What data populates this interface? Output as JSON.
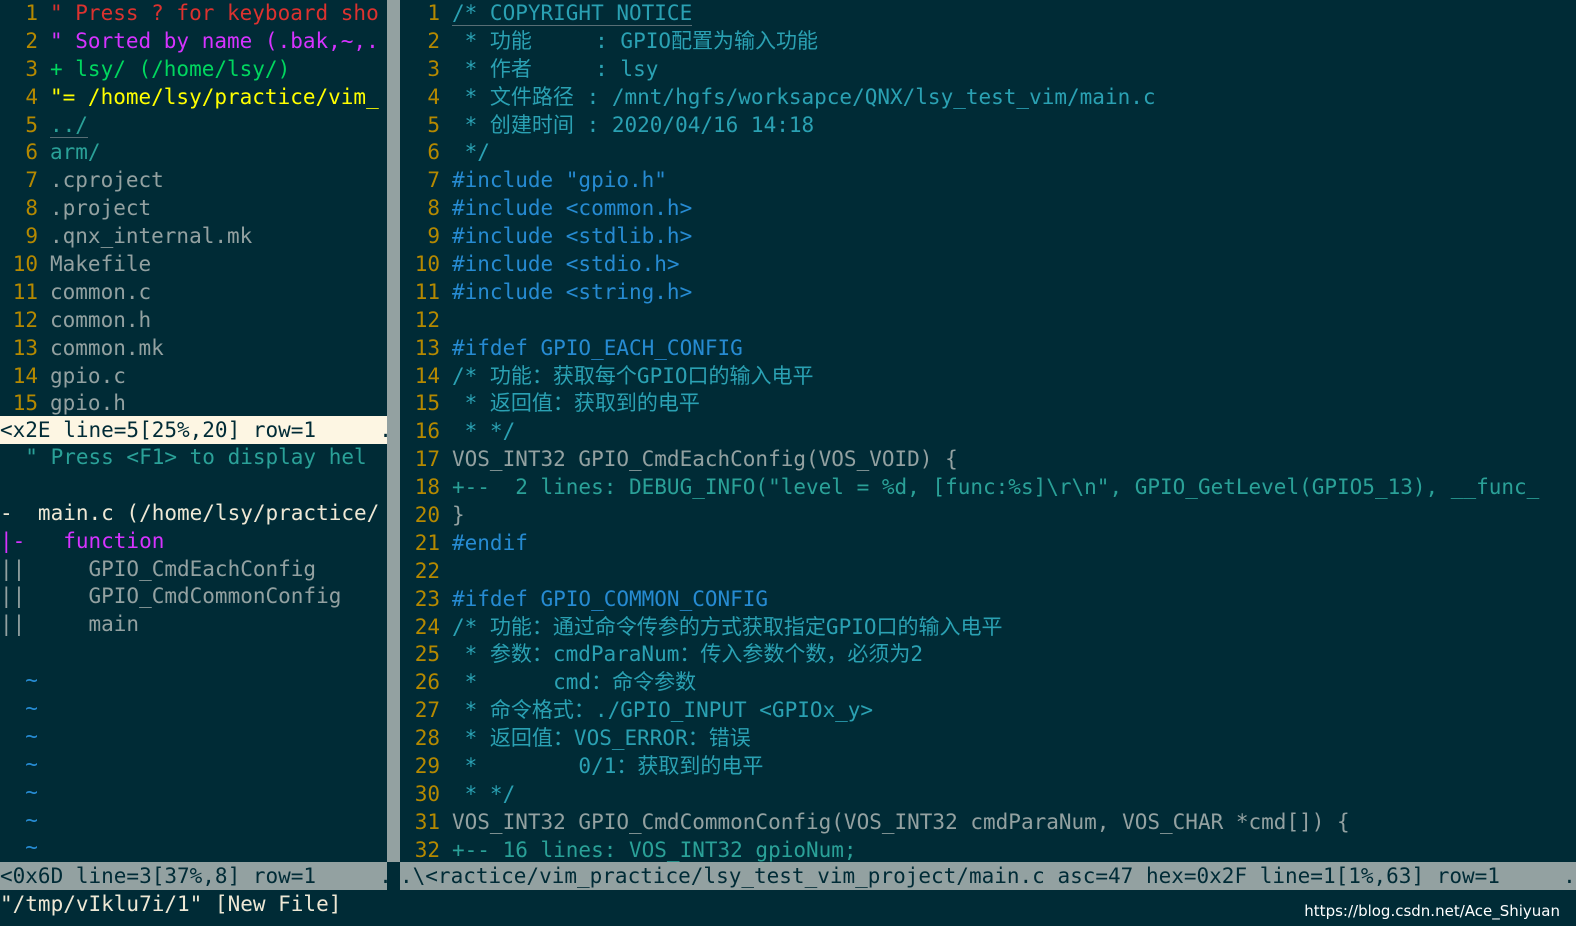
{
  "netrw": {
    "lines": [
      {
        "n": "1",
        "text": "\" Press ? for keyboard sho",
        "cls": "c-red"
      },
      {
        "n": "2",
        "text": "\" Sorted by name (.bak,~,.",
        "cls": "c-fuchsia"
      },
      {
        "n": "3",
        "text": "+ lsy/ (/home/lsy/)",
        "cls": "c-green"
      },
      {
        "n": "4",
        "text": "\"= /home/lsy/practice/vim_",
        "cls": "c-yellow"
      },
      {
        "n": "5",
        "text": "../",
        "cls": "c-teal cursorline"
      },
      {
        "n": "6",
        "text": "arm/",
        "cls": "c-teal"
      },
      {
        "n": "7",
        "text": ".cproject",
        "cls": "c-gray"
      },
      {
        "n": "8",
        "text": ".project",
        "cls": "c-gray"
      },
      {
        "n": "9",
        "text": ".qnx_internal.mk",
        "cls": "c-gray"
      },
      {
        "n": "10",
        "text": "Makefile",
        "cls": "c-gray"
      },
      {
        "n": "11",
        "text": "common.c",
        "cls": "c-gray"
      },
      {
        "n": "12",
        "text": "common.h",
        "cls": "c-gray"
      },
      {
        "n": "13",
        "text": "common.mk",
        "cls": "c-gray"
      },
      {
        "n": "14",
        "text": "gpio.c",
        "cls": "c-gray"
      },
      {
        "n": "15",
        "text": "gpio.h",
        "cls": "c-gray"
      }
    ],
    "status": "<x2E line=5[25%,20] row=1     ."
  },
  "taglist": {
    "lines": [
      {
        "text": "  \" Press <F1> to display hel",
        "cls": "c-teal"
      },
      {
        "text": "",
        "cls": ""
      },
      {
        "text": "-  main.c (/home/lsy/practice/",
        "cls": "c-white"
      },
      {
        "text": "|-   function",
        "cls": "c-fuchsia"
      },
      {
        "text": "||     GPIO_CmdEachConfig",
        "cls": "c-gray"
      },
      {
        "text": "||     GPIO_CmdCommonConfig",
        "cls": "c-gray"
      },
      {
        "text": "||     main",
        "cls": "c-gray"
      },
      {
        "text": "",
        "cls": ""
      },
      {
        "text": "  ~",
        "cls": "c-blue"
      },
      {
        "text": "  ~",
        "cls": "c-blue"
      },
      {
        "text": "  ~",
        "cls": "c-blue"
      },
      {
        "text": "  ~",
        "cls": "c-blue"
      },
      {
        "text": "  ~",
        "cls": "c-blue"
      },
      {
        "text": "  ~",
        "cls": "c-blue"
      },
      {
        "text": "  ~",
        "cls": "c-blue"
      }
    ],
    "status": "<0x6D line=3[37%,8] row=1     ."
  },
  "editor": {
    "lines": [
      {
        "n": "1",
        "text": "/* COPYRIGHT NOTICE",
        "cls": "c-comment cursorline"
      },
      {
        "n": "2",
        "text": " * 功能     : GPIO配置为输入功能",
        "cls": "c-comment"
      },
      {
        "n": "3",
        "text": " * 作者     : lsy",
        "cls": "c-comment"
      },
      {
        "n": "4",
        "text": " * 文件路径 : /mnt/hgfs/worksapce/QNX/lsy_test_vim/main.c",
        "cls": "c-comment"
      },
      {
        "n": "5",
        "text": " * 创建时间 : 2020/04/16 14:18",
        "cls": "c-comment"
      },
      {
        "n": "6",
        "text": " */",
        "cls": "c-comment"
      },
      {
        "n": "7",
        "text": "#include \"gpio.h\"",
        "cls": "c-blue"
      },
      {
        "n": "8",
        "text": "#include <common.h>",
        "cls": "c-blue"
      },
      {
        "n": "9",
        "text": "#include <stdlib.h>",
        "cls": "c-blue"
      },
      {
        "n": "10",
        "text": "#include <stdio.h>",
        "cls": "c-blue"
      },
      {
        "n": "11",
        "text": "#include <string.h>",
        "cls": "c-blue"
      },
      {
        "n": "12",
        "text": "",
        "cls": ""
      },
      {
        "n": "13",
        "text": "#ifdef GPIO_EACH_CONFIG",
        "cls": "c-blue"
      },
      {
        "n": "14",
        "text": "/* 功能：获取每个GPIO口的输入电平",
        "cls": "c-comment"
      },
      {
        "n": "15",
        "text": " * 返回值：获取到的电平",
        "cls": "c-comment"
      },
      {
        "n": "16",
        "text": " * */",
        "cls": "c-comment"
      },
      {
        "n": "17",
        "text": "VOS_INT32 GPIO_CmdEachConfig(VOS_VOID) {",
        "cls": "c-gray"
      },
      {
        "n": "18",
        "text": "+--  2 lines: DEBUG_INFO(\"level = %d, [func:%s]\\r\\n\", GPIO_GetLevel(GPIO5_13), __func_",
        "cls": "c-teal"
      },
      {
        "n": "20",
        "text": "}",
        "cls": "c-gray"
      },
      {
        "n": "21",
        "text": "#endif",
        "cls": "c-blue"
      },
      {
        "n": "22",
        "text": "",
        "cls": ""
      },
      {
        "n": "23",
        "text": "#ifdef GPIO_COMMON_CONFIG",
        "cls": "c-blue"
      },
      {
        "n": "24",
        "text": "/* 功能：通过命令传参的方式获取指定GPIO口的输入电平",
        "cls": "c-comment"
      },
      {
        "n": "25",
        "text": " * 参数：cmdParaNum：传入参数个数，必须为2",
        "cls": "c-comment"
      },
      {
        "n": "26",
        "text": " *      cmd：命令参数",
        "cls": "c-comment"
      },
      {
        "n": "27",
        "text": " * 命令格式：./GPIO_INPUT <GPIOx_y>",
        "cls": "c-comment"
      },
      {
        "n": "28",
        "text": " * 返回值：VOS_ERROR：错误",
        "cls": "c-comment"
      },
      {
        "n": "29",
        "text": " *        0/1：获取到的电平",
        "cls": "c-comment"
      },
      {
        "n": "30",
        "text": " * */",
        "cls": "c-comment"
      },
      {
        "n": "31",
        "text": "VOS_INT32 GPIO_CmdCommonConfig(VOS_INT32 cmdParaNum, VOS_CHAR *cmd[]) {",
        "cls": "c-gray"
      },
      {
        "n": "32",
        "text": "+-- 16 lines: VOS_INT32 gpioNum;",
        "cls": "c-teal"
      }
    ],
    "status": ".\\<ractice/vim_practice/lsy_test_vim_project/main.c asc=47 hex=0x2F line=1[1%,63] row=1     ."
  },
  "cmdline": "\"/tmp/vIklu7i/1\" [New File]",
  "watermark": "https://blog.csdn.net/Ace_Shiyuan"
}
